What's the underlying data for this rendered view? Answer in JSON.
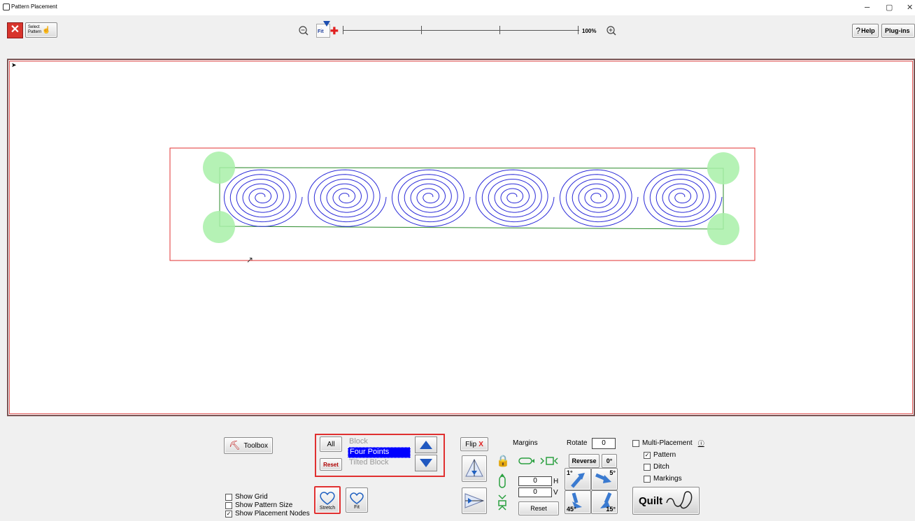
{
  "window": {
    "title": "Pattern Placement"
  },
  "toolbar": {
    "select_pattern_label": "Select Pattern",
    "fit_label": "Fit",
    "zoom_percent": "100%",
    "help_label": "Help",
    "plugins_label": "Plug-ins"
  },
  "panel": {
    "toolbox_label": "Toolbox",
    "all_label": "All",
    "reset_label": "Reset",
    "placement_options": [
      "Block",
      "Four Points",
      "Tilted Block"
    ],
    "selected_option": "Four Points",
    "show_grid": {
      "label": "Show Grid",
      "checked": false
    },
    "show_pattern_size": {
      "label": "Show Pattern Size",
      "checked": false
    },
    "show_placement_nodes": {
      "label": "Show Placement Nodes",
      "checked": true
    },
    "stretch_label": "Stretch",
    "fit_label": "Fit",
    "flip_label": "Flip",
    "flip_x": "X",
    "margins_label": "Margins",
    "margin_h_value": "0",
    "margin_h_label": "H",
    "margin_v_value": "0",
    "margin_v_label": "V",
    "margins_reset_label": "Reset",
    "rotate_label": "Rotate",
    "rotate_value": "0",
    "reverse_label": "Reverse",
    "zero_deg_label": "0°",
    "rot_1": "1°",
    "rot_5": "5°",
    "rot_45": "45°",
    "rot_15": "15°",
    "multi_placement": {
      "label": "Multi-Placement",
      "checked": false
    },
    "pattern": {
      "label": "Pattern",
      "checked": true
    },
    "ditch": {
      "label": "Ditch",
      "checked": false
    },
    "markings": {
      "label": "Markings",
      "checked": false
    },
    "quilt_label": "Quilt"
  },
  "colors": {
    "spiral": "#2a2ad8",
    "selection": "#0000ff",
    "border_red": "#e03030",
    "node_green": "#a8f0a8"
  },
  "pattern_count": 6
}
